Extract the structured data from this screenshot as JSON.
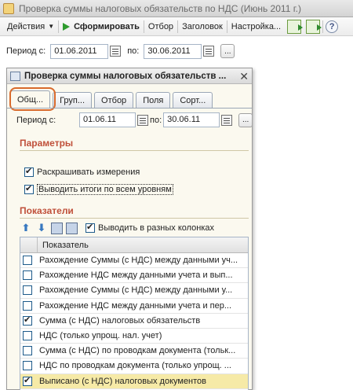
{
  "window": {
    "title": "Проверка суммы налоговых обязательств по НДС (Июнь 2011 г.)"
  },
  "toolbar": {
    "actions_label": "Действия",
    "generate_label": "Сформировать",
    "selection_label": "Отбор",
    "header_label": "Заголовок",
    "settings_label": "Настройка..."
  },
  "period": {
    "label_from": "Период с:",
    "from_value": "01.06.2011",
    "label_to": "по:",
    "to_value": "30.06.2011",
    "more_label": "..."
  },
  "dialog": {
    "title": "Проверка суммы налоговых обязательств ...",
    "tabs": [
      {
        "label": "Общ..."
      },
      {
        "label": "Груп..."
      },
      {
        "label": "Отбор"
      },
      {
        "label": "Поля"
      },
      {
        "label": "Сорт..."
      }
    ],
    "period": {
      "label_from": "Период с:",
      "from_value": "01.06.11",
      "label_to": "по:",
      "to_value": "30.06.11",
      "more_label": "..."
    },
    "params_header": "Параметры",
    "params": [
      {
        "label": "Раскрашивать измерения",
        "checked": true
      },
      {
        "label": "Выводить итоги по всем уровням",
        "checked": true
      }
    ],
    "indicators_header": "Показатели",
    "columns_option": {
      "label": "Выводить в разных колонках",
      "checked": true
    },
    "table": {
      "column": "Показатель",
      "rows": [
        {
          "label": "Рахождение Суммы (с НДС) между данными уч...",
          "checked": false
        },
        {
          "label": "Рахождение НДС между данными учета и вып...",
          "checked": false
        },
        {
          "label": "Рахождение Суммы (с НДС) между данными у...",
          "checked": false
        },
        {
          "label": "Рахождение НДС между данными учета и пер...",
          "checked": false
        },
        {
          "label": "Сумма (с НДС) налоговых обязательств",
          "checked": true
        },
        {
          "label": "НДС (только упрощ. нал. учет)",
          "checked": false
        },
        {
          "label": "Сумма (с НДС) по проводкам документа (тольк...",
          "checked": false
        },
        {
          "label": "НДС по проводкам документа (только упрощ. ...",
          "checked": false
        },
        {
          "label": "Выписано (с НДС) налоговых документов",
          "checked": true
        }
      ]
    }
  }
}
